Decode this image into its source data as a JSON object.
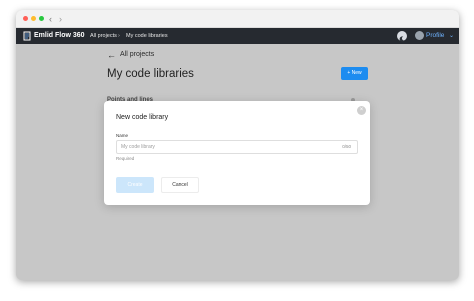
{
  "browser": {
    "back_icon": "chevron-left-icon",
    "forward_icon": "chevron-right-icon",
    "back_glyph": "‹",
    "forward_glyph": "›"
  },
  "appbar": {
    "app_name": "Emlid Flow 360",
    "logo_icon": "emlid-logo-icon",
    "breadcrumb": [
      "All projects",
      "My code libraries"
    ],
    "breadcrumb_separator": "›",
    "theme_icon": "moon-icon",
    "profile_label": "Profile",
    "profile_chevron": "⌄",
    "accent_color": "#6fb3ff"
  },
  "page": {
    "back_arrow": "←",
    "back_label": "All projects",
    "title": "My code libraries",
    "new_button_label": "+ New",
    "section_label": "Points and lines",
    "brand_color": "#1d8cf0"
  },
  "modal": {
    "title": "New code library",
    "close_icon": "close-icon",
    "close_glyph": "×",
    "name_label": "Name",
    "name_value": "",
    "name_placeholder": "My code library",
    "char_count": "0/50",
    "helper_text": "Required",
    "create_label": "Create",
    "cancel_label": "Cancel"
  }
}
